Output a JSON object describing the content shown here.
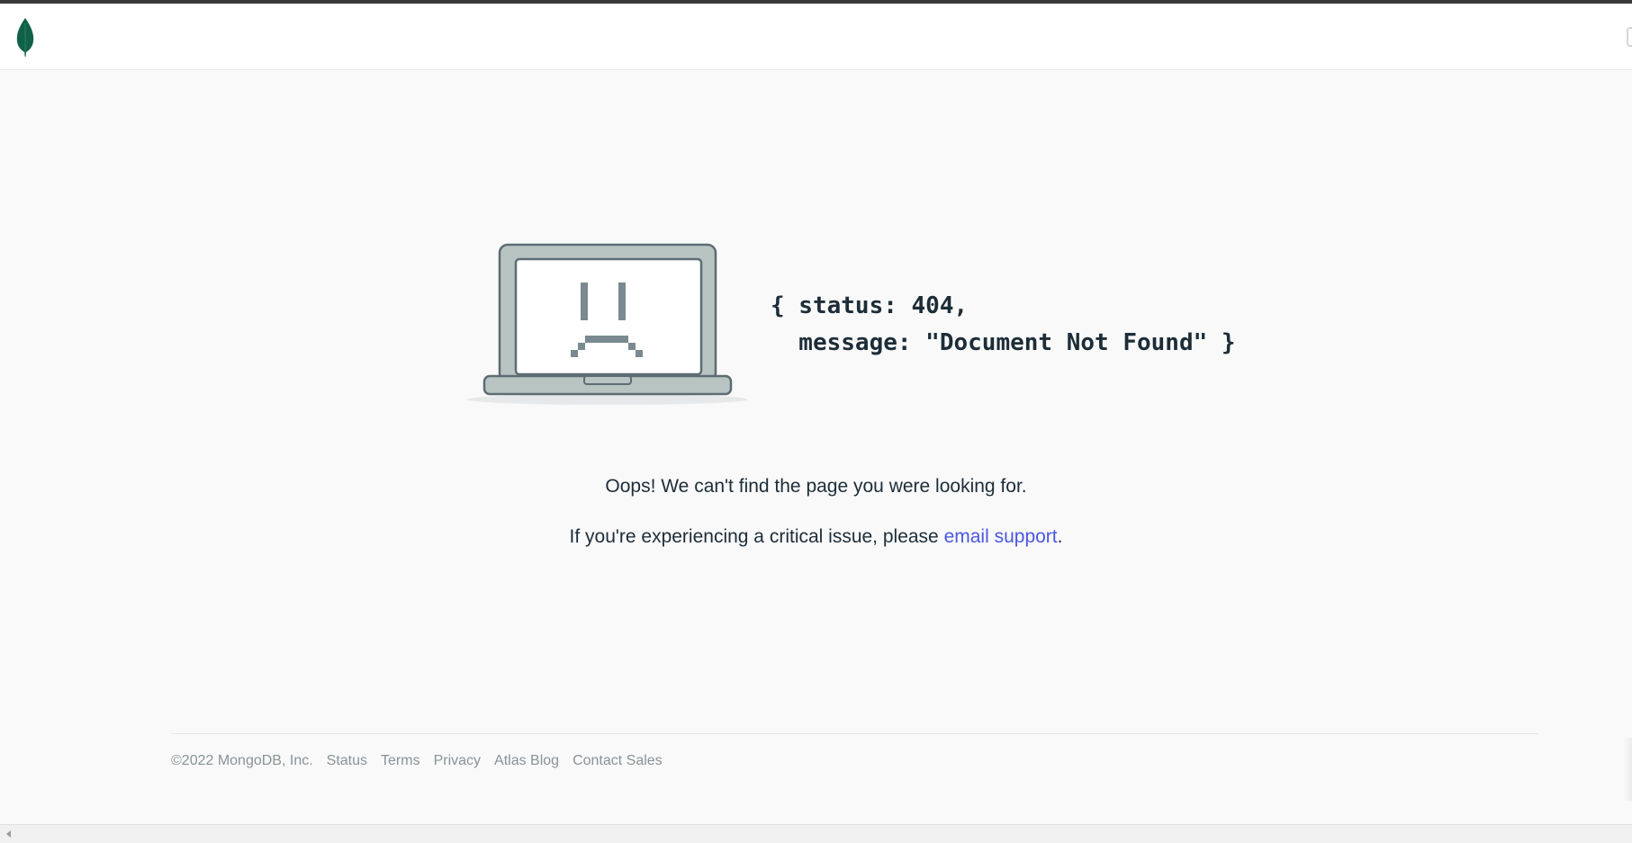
{
  "icons": {
    "brand": "mongodb-leaf-icon",
    "illustration": "sad-laptop-icon",
    "scroll": "scroll-left-arrow-icon"
  },
  "colors": {
    "leaf": "#116149",
    "link": "#4a57e0",
    "text": "#1c2d38",
    "footer_text": "#889397",
    "laptop_body": "#b8c4c2",
    "laptop_outline": "#5d6c74"
  },
  "error": {
    "code_line1": "{ status: 404,",
    "code_line2": "  message: \"Document Not Found\" }"
  },
  "message": {
    "line1": "Oops! We can't find the page you were looking for.",
    "line2_prefix": "If you're experiencing a critical issue, please ",
    "line2_link": "email support",
    "line2_suffix": "."
  },
  "footer": {
    "copyright": "©2022 MongoDB, Inc.",
    "links": [
      "Status",
      "Terms",
      "Privacy",
      "Atlas Blog",
      "Contact Sales"
    ]
  }
}
